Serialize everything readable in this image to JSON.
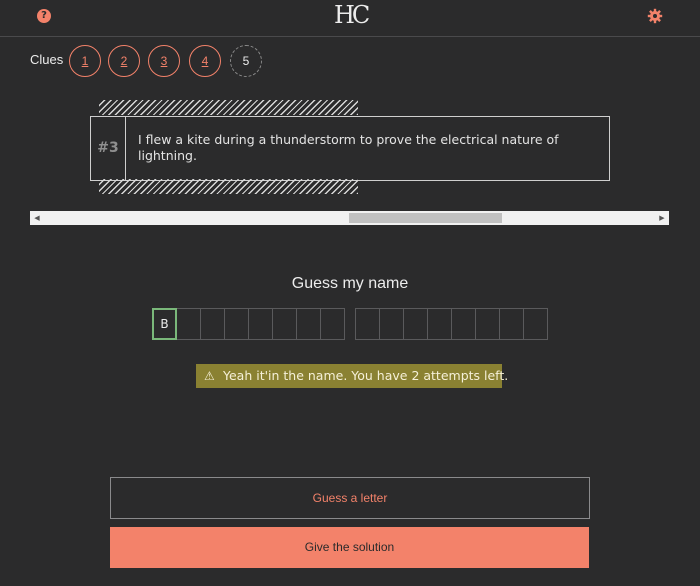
{
  "header": {
    "help_icon": "question-circle-icon",
    "help_glyph": "?",
    "logo_text": "HC",
    "settings_icon": "gear-icon",
    "accent_color": "#f3826a"
  },
  "clues": {
    "label": "Clues",
    "buttons": [
      {
        "label": "1",
        "state": "revealed"
      },
      {
        "label": "2",
        "state": "revealed"
      },
      {
        "label": "3",
        "state": "revealed"
      },
      {
        "label": "4",
        "state": "revealed"
      },
      {
        "label": "5",
        "state": "locked"
      }
    ]
  },
  "clue_card": {
    "number": "#3",
    "text": "I flew a kite during a thunderstorm to prove the electrical nature of lightning."
  },
  "scrollbar": {
    "left_arrow": "◀",
    "right_arrow": "▶"
  },
  "game": {
    "title": "Guess my name",
    "word1": [
      "B",
      "",
      "",
      "",
      "",
      "",
      "",
      ""
    ],
    "word2": [
      "",
      "",
      "",
      "",
      "",
      "",
      "",
      ""
    ]
  },
  "alert": {
    "icon": "⚠",
    "text": "Yeah it'in the name. You have 2 attempts left."
  },
  "actions": {
    "guess_letter_label": "Guess a letter",
    "give_solution_label": "Give the solution"
  }
}
